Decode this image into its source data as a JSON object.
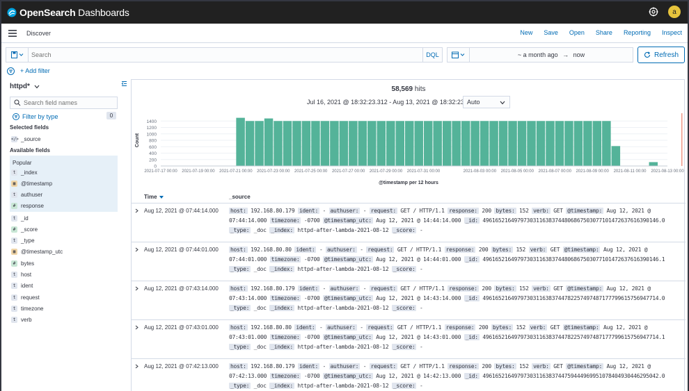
{
  "app": {
    "name_bold": "OpenSearch",
    "name_light": " Dashboards",
    "avatar_letter": "a"
  },
  "nav": {
    "title": "Discover",
    "actions": [
      "New",
      "Save",
      "Open",
      "Share",
      "Reporting",
      "Inspect"
    ]
  },
  "query": {
    "placeholder": "Search",
    "language": "DQL"
  },
  "time": {
    "start": "~ a month ago",
    "arrow": "→",
    "end": "now",
    "refresh_label": "Refresh"
  },
  "filter": {
    "add_label": "+ Add filter"
  },
  "sidebar": {
    "index_pattern": "httpd*",
    "search_placeholder": "Search field names",
    "filter_by_type": "Filter by type",
    "filter_count": "0",
    "selected_title": "Selected fields",
    "selected": [
      {
        "type": "src",
        "icon": "</>",
        "name": "_source"
      }
    ],
    "available_title": "Available fields",
    "popular_title": "Popular",
    "popular": [
      {
        "type": "str",
        "icon": "t",
        "name": "_index"
      },
      {
        "type": "date",
        "icon": "▦",
        "name": "@timestamp"
      },
      {
        "type": "str",
        "icon": "t",
        "name": "authuser"
      },
      {
        "type": "num",
        "icon": "#",
        "name": "response"
      }
    ],
    "fields": [
      {
        "type": "str",
        "icon": "t",
        "name": "_id"
      },
      {
        "type": "num",
        "icon": "#",
        "name": "_score"
      },
      {
        "type": "str",
        "icon": "t",
        "name": "_type"
      },
      {
        "type": "date",
        "icon": "▦",
        "name": "@timestamp_utc"
      },
      {
        "type": "num",
        "icon": "#",
        "name": "bytes"
      },
      {
        "type": "str",
        "icon": "t",
        "name": "host"
      },
      {
        "type": "str",
        "icon": "t",
        "name": "ident"
      },
      {
        "type": "str",
        "icon": "t",
        "name": "request"
      },
      {
        "type": "str",
        "icon": "t",
        "name": "timezone"
      },
      {
        "type": "str",
        "icon": "t",
        "name": "verb"
      }
    ]
  },
  "results": {
    "hits_count": "58,569",
    "hits_label": "hits",
    "date_range": "Jul 16, 2021 @ 18:32:23.312 - Aug 13, 2021 @ 18:32:23.312",
    "interval": "Auto",
    "time_header": "Time",
    "source_header": "_source",
    "rows": [
      {
        "time": "Aug 12, 2021 @ 07:44:14.000",
        "host": "192.168.80.179",
        "ident": "-",
        "authuser": "-",
        "request": "GET / HTTP/1.1",
        "response": "200",
        "bytes": "152",
        "verb": "GET",
        "timestamp": "Aug 12, 2021 @ 07:44:14.000",
        "timezone": "-0700",
        "timestamp_utc": "Aug 12, 2021 @ 14:44:14.000",
        "id": "49616521649797303116383744806867503077101472637616390146.0",
        "type": "_doc",
        "index": "httpd-after-lambda-2021-08-12",
        "score": "-"
      },
      {
        "time": "Aug 12, 2021 @ 07:44:01.000",
        "host": "192.168.80.80",
        "ident": "-",
        "authuser": "-",
        "request": "GET / HTTP/1.1",
        "response": "200",
        "bytes": "152",
        "verb": "GET",
        "timestamp": "Aug 12, 2021 @ 07:44:01.000",
        "timezone": "-0700",
        "timestamp_utc": "Aug 12, 2021 @ 14:44:01.000",
        "id": "49616521649797303116383744806867503077101472637616390146.1",
        "type": "_doc",
        "index": "httpd-after-lambda-2021-08-12",
        "score": "-"
      },
      {
        "time": "Aug 12, 2021 @ 07:43:14.000",
        "host": "192.168.80.179",
        "ident": "-",
        "authuser": "-",
        "request": "GET / HTTP/1.1",
        "response": "200",
        "bytes": "152",
        "verb": "GET",
        "timestamp": "Aug 12, 2021 @ 07:43:14.000",
        "timezone": "-0700",
        "timestamp_utc": "Aug 12, 2021 @ 14:43:14.000",
        "id": "49616521649797303116383744782257497487177799615756947714.0",
        "type": "_doc",
        "index": "httpd-after-lambda-2021-08-12",
        "score": "-"
      },
      {
        "time": "Aug 12, 2021 @ 07:43:01.000",
        "host": "192.168.80.80",
        "ident": "-",
        "authuser": "-",
        "request": "GET / HTTP/1.1",
        "response": "200",
        "bytes": "152",
        "verb": "GET",
        "timestamp": "Aug 12, 2021 @ 07:43:01.000",
        "timezone": "-0700",
        "timestamp_utc": "Aug 12, 2021 @ 14:43:01.000",
        "id": "49616521649797303116383744782257497487177799615756947714.1",
        "type": "_doc",
        "index": "httpd-after-lambda-2021-08-12",
        "score": "-"
      },
      {
        "time": "Aug 12, 2021 @ 07:42:13.000",
        "host": "192.168.80.179",
        "ident": "-",
        "authuser": "-",
        "request": "GET / HTTP/1.1",
        "response": "200",
        "bytes": "152",
        "verb": "GET",
        "timestamp": "Aug 12, 2021 @ 07:42:13.000",
        "timezone": "-0700",
        "timestamp_utc": "Aug 12, 2021 @ 14:42:13.000",
        "id": "49616521649797303116383744759444969951078404930446295042.0",
        "type": "_doc",
        "index": "httpd-after-lambda-2021-08-12",
        "score": "-"
      }
    ]
  },
  "colors": {
    "accent": "#006bb4",
    "bar": "#54b399",
    "topbar": "#212121",
    "avatar": "#e7c43c",
    "now_line": "#e7664c"
  },
  "chart_data": {
    "type": "bar",
    "ylabel": "Count",
    "xlabel": "@timestamp per 12 hours",
    "ylim": [
      0,
      1600
    ],
    "yticks": [
      0,
      200,
      400,
      600,
      800,
      1000,
      1200,
      1400
    ],
    "xtick_labels": [
      "2021-07-17 00:00",
      "2021-07-19 00:00",
      "2021-07-21 00:00",
      "2021-07-23 00:00",
      "2021-07-25 00:00",
      "2021-07-27 00:00",
      "2021-07-29 00:00",
      "2021-07-31 00:00",
      "2021-08-03 00:00",
      "2021-08-05 00:00",
      "2021-08-07 00:00",
      "2021-08-09 00:00",
      "2021-08-11 00:00",
      "2021-08-13 00:00"
    ],
    "xtick_dates": [
      "2021-07-17",
      "2021-07-19",
      "2021-07-21",
      "2021-07-23",
      "2021-07-25",
      "2021-07-27",
      "2021-07-29",
      "2021-07-31",
      "2021-08-03",
      "2021-08-05",
      "2021-08-07",
      "2021-08-09",
      "2021-08-11",
      "2021-08-13"
    ],
    "bars": [
      {
        "x": "2021-07-21 00:00",
        "y": 1500
      },
      {
        "x": "2021-07-21 12:00",
        "y": 1400
      },
      {
        "x": "2021-07-22 00:00",
        "y": 1400
      },
      {
        "x": "2021-07-22 12:00",
        "y": 1480
      },
      {
        "x": "2021-07-23 00:00",
        "y": 1400
      },
      {
        "x": "2021-07-23 12:00",
        "y": 1400
      },
      {
        "x": "2021-07-24 00:00",
        "y": 1400
      },
      {
        "x": "2021-07-24 12:00",
        "y": 1400
      },
      {
        "x": "2021-07-25 00:00",
        "y": 1400
      },
      {
        "x": "2021-07-25 12:00",
        "y": 1400
      },
      {
        "x": "2021-07-26 00:00",
        "y": 1400
      },
      {
        "x": "2021-07-26 12:00",
        "y": 1400
      },
      {
        "x": "2021-07-27 00:00",
        "y": 1400
      },
      {
        "x": "2021-07-27 12:00",
        "y": 1400
      },
      {
        "x": "2021-07-28 00:00",
        "y": 1400
      },
      {
        "x": "2021-07-28 12:00",
        "y": 1400
      },
      {
        "x": "2021-07-29 00:00",
        "y": 1400
      },
      {
        "x": "2021-07-29 12:00",
        "y": 1400
      },
      {
        "x": "2021-07-30 00:00",
        "y": 1400
      },
      {
        "x": "2021-07-30 12:00",
        "y": 1400
      },
      {
        "x": "2021-07-31 00:00",
        "y": 1400
      },
      {
        "x": "2021-07-31 12:00",
        "y": 1400
      },
      {
        "x": "2021-08-01 00:00",
        "y": 1400
      },
      {
        "x": "2021-08-01 12:00",
        "y": 1400
      },
      {
        "x": "2021-08-02 00:00",
        "y": 1400
      },
      {
        "x": "2021-08-02 12:00",
        "y": 1400
      },
      {
        "x": "2021-08-03 00:00",
        "y": 1400
      },
      {
        "x": "2021-08-03 12:00",
        "y": 1400
      },
      {
        "x": "2021-08-04 00:00",
        "y": 1400
      },
      {
        "x": "2021-08-04 12:00",
        "y": 1400
      },
      {
        "x": "2021-08-05 00:00",
        "y": 1400
      },
      {
        "x": "2021-08-05 12:00",
        "y": 1400
      },
      {
        "x": "2021-08-06 00:00",
        "y": 1400
      },
      {
        "x": "2021-08-06 12:00",
        "y": 1400
      },
      {
        "x": "2021-08-07 00:00",
        "y": 1400
      },
      {
        "x": "2021-08-07 12:00",
        "y": 1400
      },
      {
        "x": "2021-08-08 00:00",
        "y": 1400
      },
      {
        "x": "2021-08-08 12:00",
        "y": 1400
      },
      {
        "x": "2021-08-09 00:00",
        "y": 1400
      },
      {
        "x": "2021-08-09 12:00",
        "y": 1400
      },
      {
        "x": "2021-08-10 00:00",
        "y": 620
      },
      {
        "x": "2021-08-12 00:00",
        "y": 120
      }
    ],
    "now_marker": "2021-08-13 18:32"
  }
}
